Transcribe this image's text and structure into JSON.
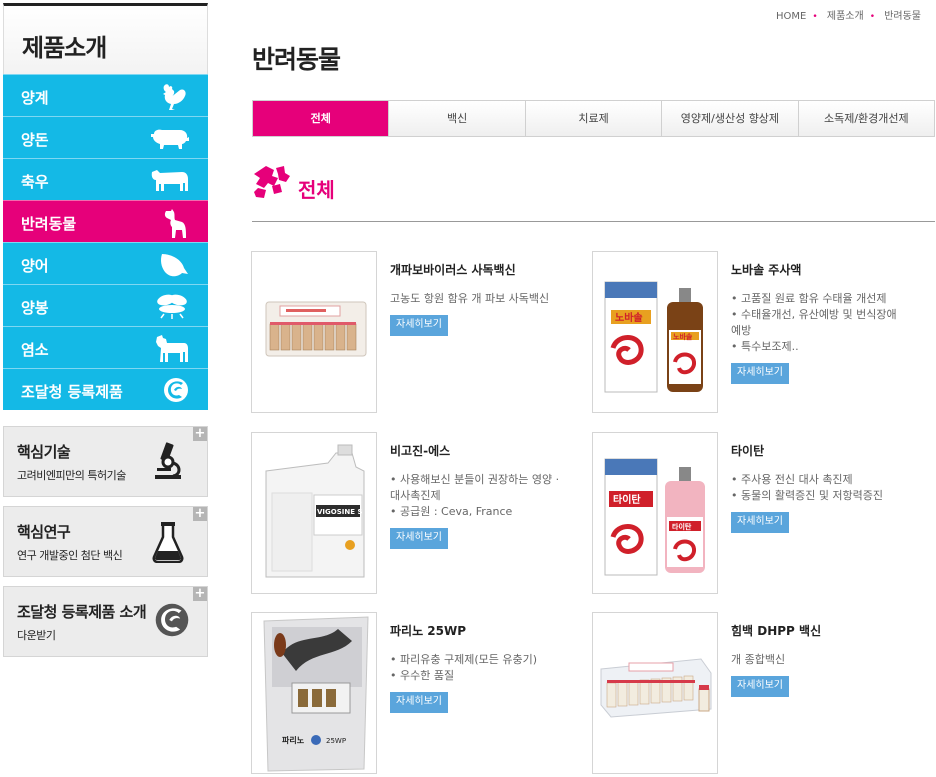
{
  "sidebar": {
    "title": "제품소개",
    "items": [
      {
        "label": "양계",
        "icon": "rooster-icon"
      },
      {
        "label": "양돈",
        "icon": "pig-icon"
      },
      {
        "label": "축우",
        "icon": "cow-icon"
      },
      {
        "label": "반려동물",
        "icon": "dog-icon",
        "active": true
      },
      {
        "label": "양어",
        "icon": "fish-icon"
      },
      {
        "label": "양봉",
        "icon": "bee-icon"
      },
      {
        "label": "염소",
        "icon": "goat-icon"
      },
      {
        "label": "조달청 등록제품",
        "icon": "procurement-logo-icon"
      }
    ],
    "boxes": [
      {
        "title": "핵심기술",
        "subtitle": "고려비엔피만의 특허기술",
        "icon": "microscope-icon"
      },
      {
        "title": "핵심연구",
        "subtitle": "연구 개발중인 첨단 백신",
        "icon": "flask-icon"
      },
      {
        "title": "조달청 등록제품 소개",
        "subtitle": "다운받기",
        "icon": "procurement-logo-icon"
      }
    ],
    "plus": "+"
  },
  "breadcrumb": [
    "HOME",
    "제품소개",
    "반려동물"
  ],
  "page_title": "반려동물",
  "tabs": [
    "전체",
    "백신",
    "치료제",
    "영양제/생산성 향상제",
    "소독제/환경개선제"
  ],
  "active_tab": 0,
  "section_title": "전체",
  "more_label": "자세히보기",
  "products": [
    {
      "name": "개파보바이러스 사독백신",
      "desc": [
        "고농도 항원 함유 개 파보 사독백신"
      ]
    },
    {
      "name": "노바솔 주사액",
      "desc": [
        "• 고품질 원료 함유 수태율 개선제",
        "• 수태율개선, 유산예방 및 번식장애예방",
        "• 특수보조제.."
      ]
    },
    {
      "name": "비고진-에스",
      "desc": [
        "• 사용해보신 분들이 권장하는 영양 · 대사촉진제",
        "• 공급원 : Ceva, France"
      ]
    },
    {
      "name": "타이탄",
      "desc": [
        "• 주사용 전신 대사 촉진제",
        "• 동물의 활력증진 및 저항력증진"
      ]
    },
    {
      "name": "파리노 25WP",
      "desc": [
        "• 파리유충 구제제(모든 유충기)",
        "• 우수한 품질"
      ]
    },
    {
      "name": "힘백 DHPP 백신",
      "desc": [
        "개 종합백신"
      ]
    }
  ],
  "packaging_text": {
    "vigosine": "VIGOSINE S",
    "novasol": "노바솔",
    "titan": "타이탄",
    "parino": "파리노",
    "parino_code": "25WP"
  },
  "colors": {
    "sky": "#14b9e6",
    "magenta": "#e6007a",
    "button": "#5aa5dc"
  }
}
